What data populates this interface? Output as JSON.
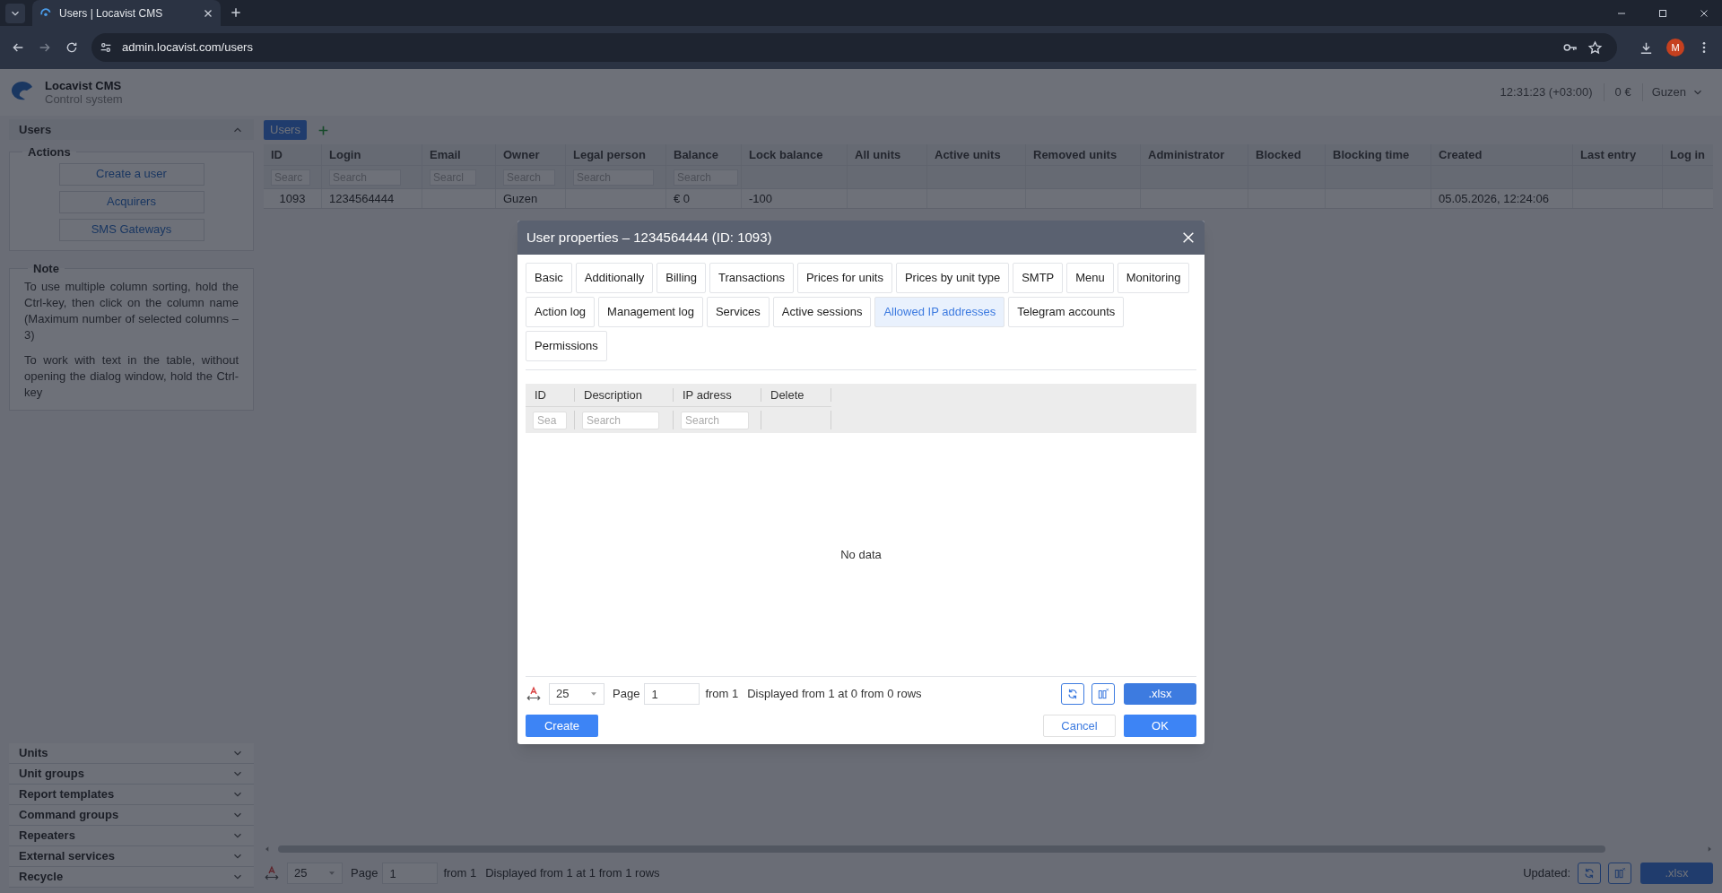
{
  "browser": {
    "tab_title": "Users | Locavist CMS",
    "url": "admin.locavist.com/users",
    "profile_initial": "M"
  },
  "app": {
    "name": "Locavist CMS",
    "subtitle": "Control system",
    "time": "12:31:23 (+03:00)",
    "balance": "0 €",
    "user": "Guzen"
  },
  "sidebar": {
    "sections": [
      {
        "title": "Users",
        "expanded": true,
        "actions": {
          "legend": "Actions",
          "buttons": [
            "Create a user",
            "Acquirers",
            "SMS Gateways"
          ]
        },
        "note": {
          "legend": "Note",
          "paragraphs": [
            "To use multiple column sorting, hold the Ctrl-key, then click on the column name (Maximum number of selected columns – 3)",
            "To work with text in the table, without opening the dialog window, hold the Ctrl-key"
          ]
        }
      },
      {
        "title": "Units",
        "expanded": false
      },
      {
        "title": "Unit groups",
        "expanded": false
      },
      {
        "title": "Report templates",
        "expanded": false
      },
      {
        "title": "Command groups",
        "expanded": false
      },
      {
        "title": "Repeaters",
        "expanded": false
      },
      {
        "title": "External services",
        "expanded": false
      },
      {
        "title": "Recycle",
        "expanded": false
      }
    ]
  },
  "page_tabs": [
    {
      "label": "Users",
      "selected": true
    }
  ],
  "table": {
    "columns": [
      {
        "label": "ID",
        "placeholder": "Searc"
      },
      {
        "label": "Login",
        "placeholder": "Search"
      },
      {
        "label": "Email",
        "placeholder": "Searcl"
      },
      {
        "label": "Owner",
        "placeholder": "Search"
      },
      {
        "label": "Legal person",
        "placeholder": "Search"
      },
      {
        "label": "Balance",
        "placeholder": "Search"
      },
      {
        "label": "Lock balance"
      },
      {
        "label": "All units"
      },
      {
        "label": "Active units"
      },
      {
        "label": "Removed units"
      },
      {
        "label": "Administrator"
      },
      {
        "label": "Blocked"
      },
      {
        "label": "Blocking time"
      },
      {
        "label": "Created"
      },
      {
        "label": "Last entry"
      },
      {
        "label": "Log in"
      }
    ],
    "rows": [
      {
        "cells": [
          "1093",
          "1234564444",
          null,
          "Guzen",
          null,
          "€ 0",
          "-100",
          null,
          null,
          null,
          null,
          null,
          null,
          "05.05.2026, 12:24:06",
          null,
          null
        ]
      }
    ]
  },
  "pagination": {
    "page_size": "25",
    "page_label": "Page",
    "page": "1",
    "total": "from 1",
    "summary": "Displayed from 1 at 1 from 1 rows",
    "updated_label": "Updated:",
    "export": ".xlsx"
  },
  "dialog": {
    "title": "User properties – 1234564444 (ID: 1093)",
    "tabs": [
      {
        "label": "Basic",
        "selected": false
      },
      {
        "label": "Additionally",
        "selected": false
      },
      {
        "label": "Billing",
        "selected": false
      },
      {
        "label": "Transactions",
        "selected": false
      },
      {
        "label": "Prices for units",
        "selected": false
      },
      {
        "label": "Prices by unit type",
        "selected": false
      },
      {
        "label": "SMTP",
        "selected": false
      },
      {
        "label": "Menu",
        "selected": false
      },
      {
        "label": "Monitoring",
        "selected": false
      },
      {
        "label": "Action log",
        "selected": false
      },
      {
        "label": "Management log",
        "selected": false
      },
      {
        "label": "Services",
        "selected": false
      },
      {
        "label": "Active sessions",
        "selected": false
      },
      {
        "label": "Allowed IP addresses",
        "selected": true
      },
      {
        "label": "Telegram accounts",
        "selected": false
      },
      {
        "label": "Permissions",
        "selected": false
      }
    ],
    "table": {
      "columns": [
        {
          "label": "ID",
          "placeholder": "Sea"
        },
        {
          "label": "Description",
          "placeholder": "Search"
        },
        {
          "label": "IP adress",
          "placeholder": "Search"
        },
        {
          "label": "Delete"
        }
      ],
      "empty_text": "No data"
    },
    "pagination": {
      "page_size": "25",
      "page_label": "Page",
      "page": "1",
      "total": "from 1",
      "summary": "Displayed from 1 at 0 from 0 rows",
      "export": ".xlsx"
    },
    "buttons": {
      "create": "Create",
      "cancel": "Cancel",
      "ok": "OK"
    }
  }
}
